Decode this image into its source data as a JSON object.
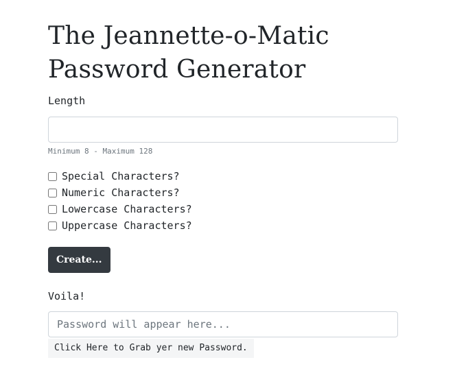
{
  "header": {
    "title_line1": "The Jeannette-o-Matic",
    "title_line2": "Password Generator"
  },
  "length": {
    "label": "Length",
    "value": "",
    "hint": "Minimum 8 - Maximum 128"
  },
  "options": [
    {
      "label": "Special Characters?",
      "checked": false
    },
    {
      "label": "Numeric Characters?",
      "checked": false
    },
    {
      "label": "Lowercase Characters?",
      "checked": false
    },
    {
      "label": "Uppercase Characters?",
      "checked": false
    }
  ],
  "create_button": {
    "label": "Create..."
  },
  "output": {
    "label": "Voila!",
    "placeholder": "Password will appear here...",
    "value": ""
  },
  "copy_button": {
    "label": "Click Here to Grab yer new Password."
  },
  "colors": {
    "button_dark": "#343a40",
    "input_border": "#ced4da",
    "hint_gray": "#6c757d",
    "copy_bg": "#f4f5f6"
  }
}
